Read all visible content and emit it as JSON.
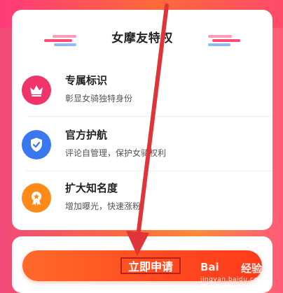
{
  "card": {
    "title": "女摩友特权",
    "features": [
      {
        "title": "专属标识",
        "description": "彰显女骑独特身份",
        "icon": "crown-icon",
        "color": "#f0346a"
      },
      {
        "title": "官方护航",
        "description": "评论自管理，保护女骑权利",
        "icon": "shield-check-icon",
        "color": "#3a78f0"
      },
      {
        "title": "扩大知名度",
        "description": "增加曝光，快速涨粉",
        "icon": "medal-star-icon",
        "color": "#ff8a1a"
      }
    ]
  },
  "action": {
    "apply_label": "立即申请"
  },
  "watermark": {
    "brand": "Bai",
    "suffix": "经验",
    "domain": "jingyan.baidu.com"
  },
  "colors": {
    "accent": "#ff4a1f",
    "annotation": "#e0343b"
  }
}
